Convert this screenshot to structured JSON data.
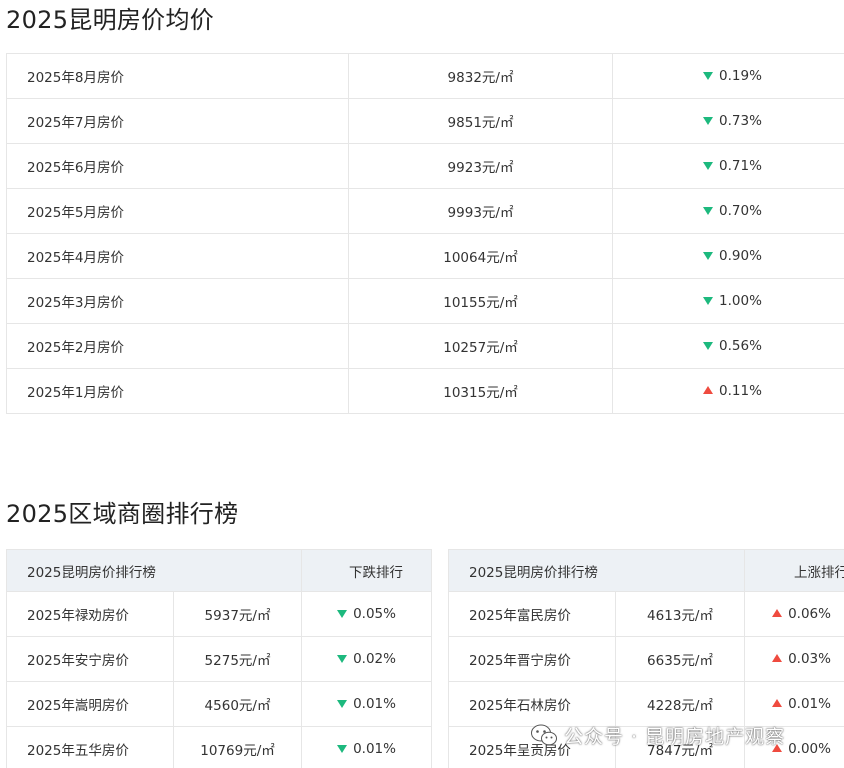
{
  "section1": {
    "title": "2025昆明房价均价",
    "rows": [
      {
        "label": "2025年8月房价",
        "price": "9832元/㎡",
        "change": "0.19%",
        "dir": "down"
      },
      {
        "label": "2025年7月房价",
        "price": "9851元/㎡",
        "change": "0.73%",
        "dir": "down"
      },
      {
        "label": "2025年6月房价",
        "price": "9923元/㎡",
        "change": "0.71%",
        "dir": "down"
      },
      {
        "label": "2025年5月房价",
        "price": "9993元/㎡",
        "change": "0.70%",
        "dir": "down"
      },
      {
        "label": "2025年4月房价",
        "price": "10064元/㎡",
        "change": "0.90%",
        "dir": "down"
      },
      {
        "label": "2025年3月房价",
        "price": "10155元/㎡",
        "change": "1.00%",
        "dir": "down"
      },
      {
        "label": "2025年2月房价",
        "price": "10257元/㎡",
        "change": "0.56%",
        "dir": "down"
      },
      {
        "label": "2025年1月房价",
        "price": "10315元/㎡",
        "change": "0.11%",
        "dir": "up"
      }
    ]
  },
  "section2": {
    "title": "2025区域商圈排行榜",
    "falling": {
      "header_left": "2025昆明房价排行榜",
      "header_right": "下跌排行",
      "rows": [
        {
          "label": "2025年禄劝房价",
          "price": "5937元/㎡",
          "change": "0.05%",
          "dir": "down"
        },
        {
          "label": "2025年安宁房价",
          "price": "5275元/㎡",
          "change": "0.02%",
          "dir": "down"
        },
        {
          "label": "2025年嵩明房价",
          "price": "4560元/㎡",
          "change": "0.01%",
          "dir": "down"
        },
        {
          "label": "2025年五华房价",
          "price": "10769元/㎡",
          "change": "0.01%",
          "dir": "down"
        }
      ]
    },
    "rising": {
      "header_left": "2025昆明房价排行榜",
      "header_right": "上涨排行",
      "rows": [
        {
          "label": "2025年富民房价",
          "price": "4613元/㎡",
          "change": "0.06%",
          "dir": "up"
        },
        {
          "label": "2025年晋宁房价",
          "price": "6635元/㎡",
          "change": "0.03%",
          "dir": "up"
        },
        {
          "label": "2025年石林房价",
          "price": "4228元/㎡",
          "change": "0.01%",
          "dir": "up"
        },
        {
          "label": "2025年呈贡房价",
          "price": "7847元/㎡",
          "change": "0.00%",
          "dir": "up"
        }
      ]
    }
  },
  "watermark": {
    "text": "公众号 · 昆明房地产观察",
    "icon": "wechat-icon"
  },
  "colors": {
    "down": "#1db97e",
    "up": "#ef4b3f",
    "header_bg": "#edf1f5",
    "border": "#e6e6e6"
  }
}
